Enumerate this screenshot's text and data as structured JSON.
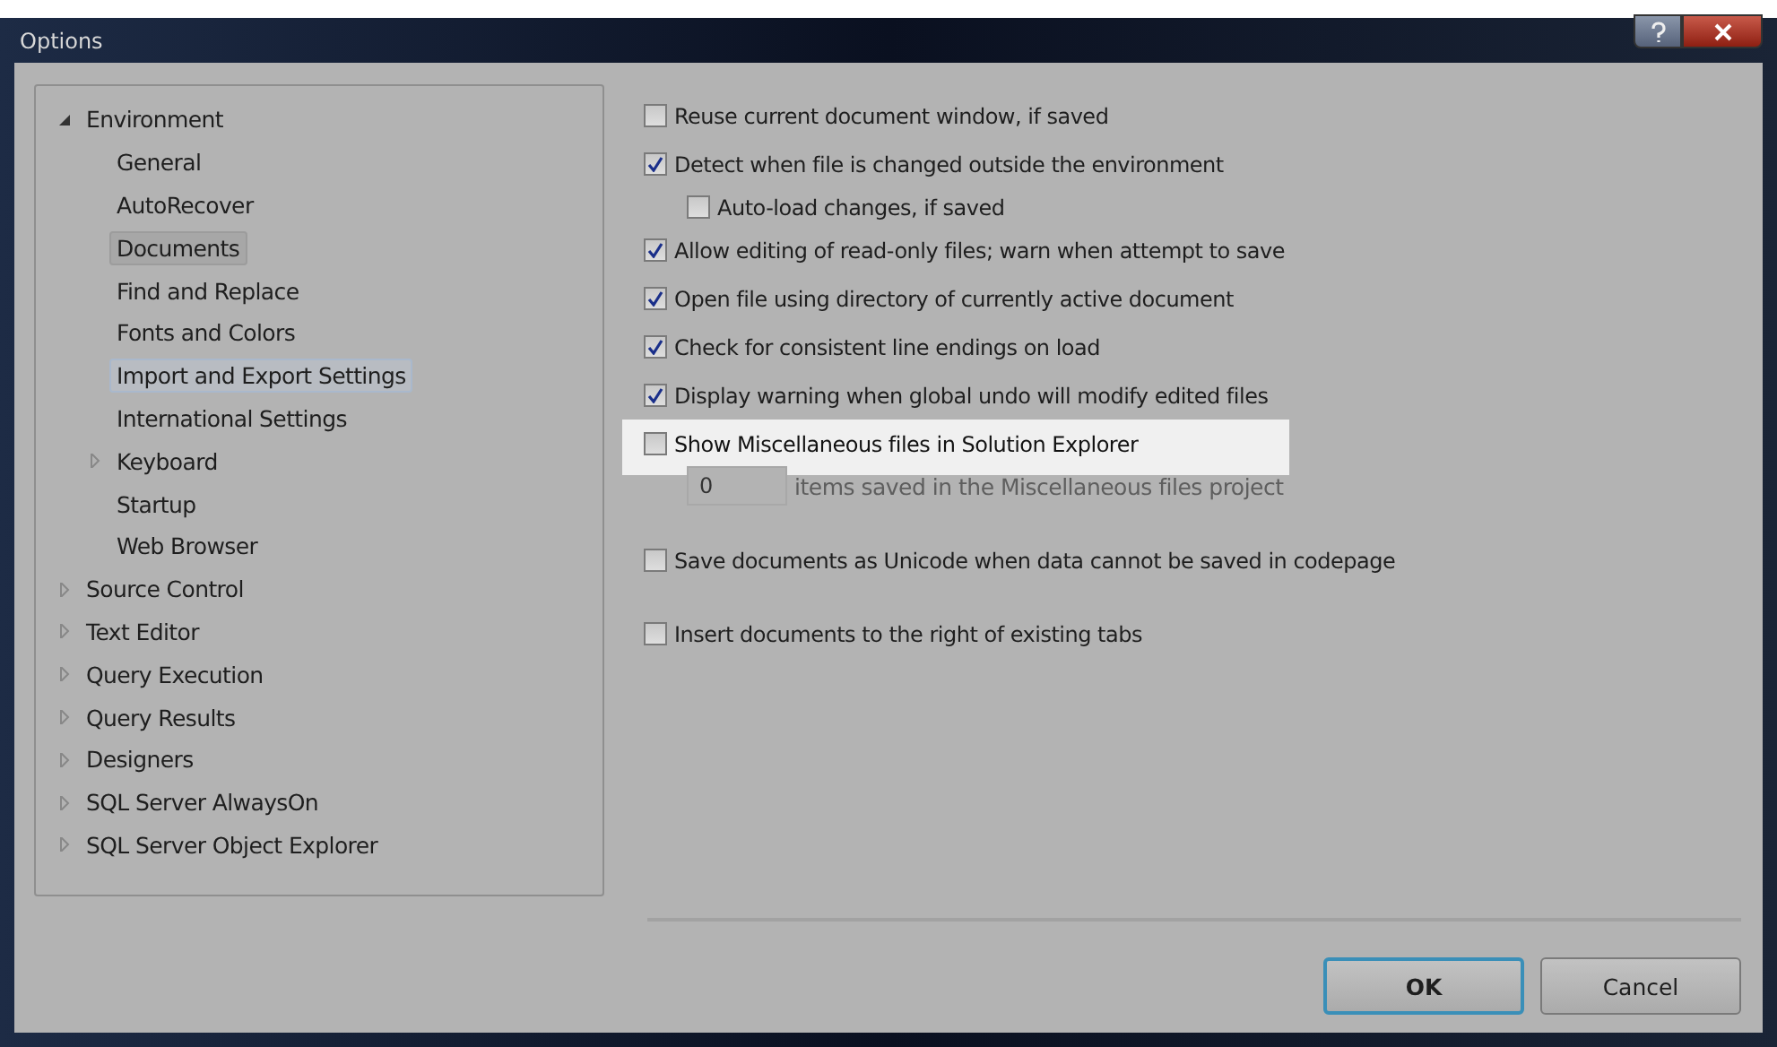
{
  "window": {
    "title": "Options"
  },
  "tree": [
    {
      "label": "Environment",
      "expanded": true,
      "selected": false,
      "children": [
        {
          "label": "General",
          "selected": false,
          "hovered": false
        },
        {
          "label": "AutoRecover",
          "selected": false,
          "hovered": false
        },
        {
          "label": "Documents",
          "selected": true,
          "hovered": false
        },
        {
          "label": "Find and Replace",
          "selected": false,
          "hovered": false
        },
        {
          "label": "Fonts and Colors",
          "selected": false,
          "hovered": false
        },
        {
          "label": "Import and Export Settings",
          "selected": false,
          "hovered": true
        },
        {
          "label": "International Settings",
          "selected": false,
          "hovered": false
        },
        {
          "label": "Keyboard",
          "selected": false,
          "hovered": false,
          "expanded": false
        },
        {
          "label": "Startup",
          "selected": false,
          "hovered": false
        },
        {
          "label": "Web Browser",
          "selected": false,
          "hovered": false
        }
      ]
    },
    {
      "label": "Source Control",
      "expanded": false,
      "selected": false
    },
    {
      "label": "Text Editor",
      "expanded": false,
      "selected": false
    },
    {
      "label": "Query Execution",
      "expanded": false,
      "selected": false
    },
    {
      "label": "Query Results",
      "expanded": false,
      "selected": false
    },
    {
      "label": "Designers",
      "expanded": false,
      "selected": false
    },
    {
      "label": "SQL Server AlwaysOn",
      "expanded": false,
      "selected": false
    },
    {
      "label": "SQL Server Object Explorer",
      "expanded": false,
      "selected": false
    }
  ],
  "option_groups": [
    [
      {
        "label": "Reuse current document window, if saved",
        "checked": false,
        "highlighted": false
      },
      {
        "label": "Detect when file is changed outside the environment",
        "checked": true,
        "highlighted": false,
        "children": [
          {
            "label": "Auto-load changes, if saved",
            "checked": false
          }
        ]
      },
      {
        "label": "Allow editing of read-only files; warn when attempt to save",
        "checked": true,
        "highlighted": false
      },
      {
        "label": "Open file using directory of currently active document",
        "checked": true,
        "highlighted": false
      },
      {
        "label": "Check for consistent line endings on load",
        "checked": true,
        "highlighted": false
      },
      {
        "label": "Display warning when global undo will modify edited files",
        "checked": true,
        "highlighted": false
      },
      {
        "label": "Show Miscellaneous files in Solution Explorer",
        "checked": false,
        "highlighted": true,
        "field": {
          "value": "0",
          "label": "items saved in the Miscellaneous files project",
          "disabled": true
        }
      }
    ],
    [
      {
        "label": "Save documents as Unicode when data cannot be saved in codepage",
        "checked": false,
        "highlighted": false
      }
    ],
    [
      {
        "label": "Insert documents to the right of existing tabs",
        "checked": false,
        "highlighted": false
      }
    ]
  ],
  "buttons": [
    {
      "label": "OK",
      "default": true
    },
    {
      "label": "Cancel",
      "default": false
    }
  ]
}
